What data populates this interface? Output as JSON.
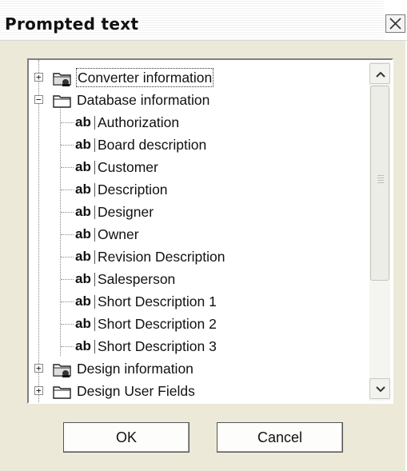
{
  "window": {
    "title": "Prompted text"
  },
  "tree": {
    "items": [
      {
        "label": "Converter information",
        "type": "folder-special",
        "expander": "+",
        "selected": true
      },
      {
        "label": "Database information",
        "type": "folder-open",
        "expander": "−"
      },
      {
        "label": "Authorization",
        "type": "text-field"
      },
      {
        "label": "Board description",
        "type": "text-field"
      },
      {
        "label": "Customer",
        "type": "text-field"
      },
      {
        "label": "Description",
        "type": "text-field"
      },
      {
        "label": "Designer",
        "type": "text-field"
      },
      {
        "label": "Owner",
        "type": "text-field"
      },
      {
        "label": "Revision Description",
        "type": "text-field"
      },
      {
        "label": "Salesperson",
        "type": "text-field"
      },
      {
        "label": "Short Description 1",
        "type": "text-field"
      },
      {
        "label": "Short Description 2",
        "type": "text-field"
      },
      {
        "label": "Short Description 3",
        "type": "text-field"
      },
      {
        "label": "Design information",
        "type": "folder-special",
        "expander": "+"
      },
      {
        "label": "Design User Fields",
        "type": "folder",
        "expander": "+"
      }
    ],
    "field_icon_text": "ab"
  },
  "buttons": {
    "ok": "OK",
    "cancel": "Cancel"
  }
}
